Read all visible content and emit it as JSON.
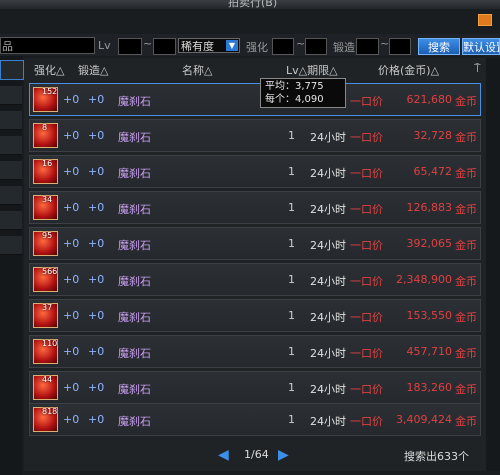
{
  "window": {
    "title": "拍卖行(B)"
  },
  "filters": {
    "category_label": "品",
    "lv_label": "Lv",
    "tilde": "~",
    "rarity_selected": "稀有度",
    "strengthen_label": "强化",
    "forge_label": "锻造",
    "search_button": "搜索",
    "default_button": "默认设置"
  },
  "table": {
    "headers": {
      "strengthen": "强化△",
      "forge": "锻造△",
      "name": "名称△",
      "lv_term": "Lv△期限△",
      "price": "价格(金币)△"
    },
    "rows": [
      {
        "lv_badge": "152",
        "strengthen": "+0",
        "forge": "+0",
        "name": "魔刹石",
        "level": "",
        "duration": "",
        "price_type": "一口价",
        "price": "621,680",
        "unit": "金币"
      },
      {
        "lv_badge": "8",
        "strengthen": "+0",
        "forge": "+0",
        "name": "魔刹石",
        "level": "1",
        "duration": "24小时",
        "price_type": "一口价",
        "price": "32,728",
        "unit": "金币"
      },
      {
        "lv_badge": "16",
        "strengthen": "+0",
        "forge": "+0",
        "name": "魔刹石",
        "level": "1",
        "duration": "24小时",
        "price_type": "一口价",
        "price": "65,472",
        "price_unit_hint": "",
        "unit": "金币"
      },
      {
        "lv_badge": "34",
        "strengthen": "+0",
        "forge": "+0",
        "name": "魔刹石",
        "level": "1",
        "duration": "24小时",
        "price_type": "一口价",
        "price": "126,883",
        "unit": "金币"
      },
      {
        "lv_badge": "95",
        "strengthen": "+0",
        "forge": "+0",
        "name": "魔刹石",
        "level": "1",
        "duration": "24小时",
        "price_type": "一口价",
        "price": "392,065",
        "unit": "金币"
      },
      {
        "lv_badge": "566",
        "strengthen": "+0",
        "forge": "+0",
        "name": "魔刹石",
        "level": "1",
        "duration": "24小时",
        "price_type": "一口价",
        "price": "2,348,900",
        "unit": "金币"
      },
      {
        "lv_badge": "37",
        "strengthen": "+0",
        "forge": "+0",
        "name": "魔刹石",
        "level": "1",
        "duration": "24小时",
        "price_type": "一口价",
        "price": "153,550",
        "unit": "金币"
      },
      {
        "lv_badge": "110",
        "strengthen": "+0",
        "forge": "+0",
        "name": "魔刹石",
        "level": "1",
        "duration": "24小时",
        "price_type": "一口价",
        "price": "457,710",
        "unit": "金币"
      },
      {
        "lv_badge": "44",
        "strengthen": "+0",
        "forge": "+0",
        "name": "魔刹石",
        "level": "1",
        "duration": "24小时",
        "price_type": "一口价",
        "price": "183,260",
        "unit": "金币"
      },
      {
        "lv_badge": "818",
        "strengthen": "+0",
        "forge": "+0",
        "name": "魔刹石",
        "level": "1",
        "duration": "24小时",
        "price_type": "一口价",
        "price": "3,409,424",
        "unit": "金币"
      }
    ]
  },
  "tooltip": {
    "avg_label": "平均：3,775",
    "each_label": "每个：4,090"
  },
  "pager": {
    "current": "1/64",
    "total": "搜索出633个"
  }
}
